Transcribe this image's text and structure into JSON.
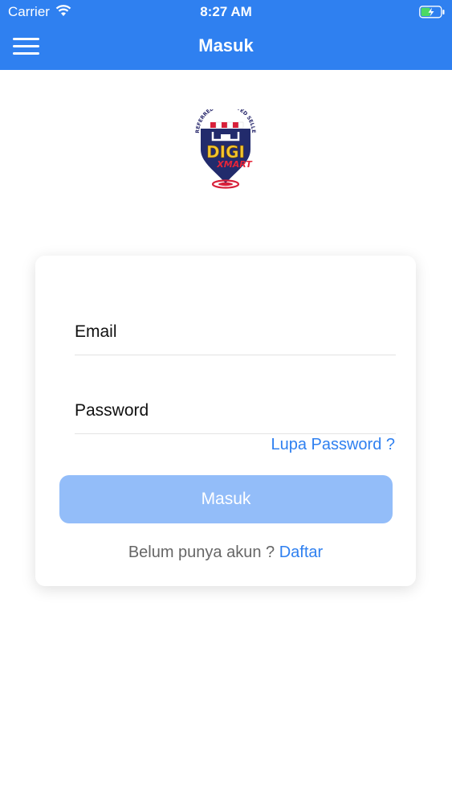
{
  "status_bar": {
    "carrier": "Carrier",
    "time": "8:27 AM"
  },
  "nav": {
    "title": "Masuk"
  },
  "logo": {
    "top_text": "PREFERRED & TRUSTED SELLER",
    "brand": "DIGI",
    "suffix": "XMART"
  },
  "form": {
    "email_placeholder": "Email",
    "password_placeholder": "Password",
    "forgot_label": "Lupa Password ?",
    "submit_label": "Masuk",
    "register_prompt": "Belum punya akun ?",
    "register_link": "Daftar"
  },
  "colors": {
    "accent": "#2f80f0",
    "button_disabled": "#93bdf9"
  }
}
